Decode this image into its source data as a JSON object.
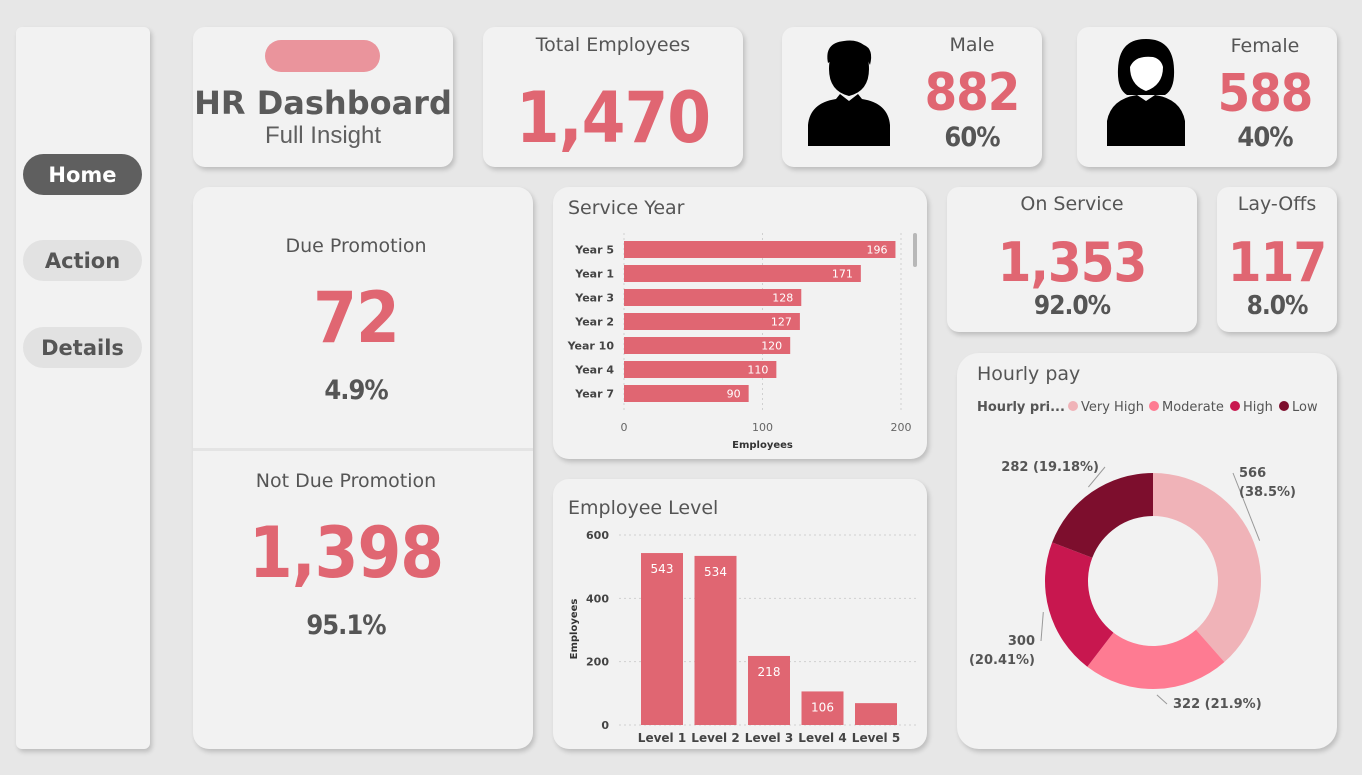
{
  "nav": {
    "home": "Home",
    "action": "Action",
    "details": "Details"
  },
  "title": {
    "main": "HR Dashboard",
    "sub": "Full Insight"
  },
  "total": {
    "label": "Total Employees",
    "value": "1,470"
  },
  "male": {
    "label": "Male",
    "value": "882",
    "pct": "60%"
  },
  "female": {
    "label": "Female",
    "value": "588",
    "pct": "40%"
  },
  "promotion": {
    "due_label": "Due Promotion",
    "due_value": "72",
    "due_pct": "4.9%",
    "notdue_label": "Not Due Promotion",
    "notdue_value": "1,398",
    "notdue_pct": "95.1%"
  },
  "onservice": {
    "label": "On Service",
    "value": "1,353",
    "pct": "92.0%"
  },
  "layoffs": {
    "label": "Lay-Offs",
    "value": "117",
    "pct": "8.0%"
  },
  "colors": {
    "accent": "#e06672",
    "very_high": "#f0b3b8",
    "moderate": "#fe7b92",
    "high": "#c8174f",
    "low": "#7d0e2d"
  },
  "chart_data": [
    {
      "id": "service_year",
      "type": "bar",
      "orientation": "horizontal",
      "title": "Service Year",
      "xlabel": "Employees",
      "categories": [
        "Year 5",
        "Year 1",
        "Year 3",
        "Year 2",
        "Year 10",
        "Year 4",
        "Year 7"
      ],
      "values": [
        196,
        171,
        128,
        127,
        120,
        110,
        90
      ],
      "xticks": [
        "0",
        "100",
        "200"
      ],
      "xlim": [
        0,
        200
      ]
    },
    {
      "id": "employee_level",
      "type": "bar",
      "title": "Employee Level",
      "ylabel": "Employees",
      "categories": [
        "Level 1",
        "Level 2",
        "Level 3",
        "Level 4",
        "Level 5"
      ],
      "values": [
        543,
        534,
        218,
        106,
        69
      ],
      "labels": [
        "543",
        "534",
        "218",
        "106",
        ""
      ],
      "yticks": [
        "0",
        "200",
        "400",
        "600"
      ],
      "ylim": [
        0,
        600
      ]
    },
    {
      "id": "hourly_pay",
      "type": "pie",
      "title": "Hourly pay",
      "legend_title": "Hourly pri...",
      "legend_position": "top",
      "slices": [
        {
          "name": "Very High",
          "value": 566,
          "label1": "566",
          "label2": "(38.5%)"
        },
        {
          "name": "Moderate",
          "value": 322,
          "label1": "322 (21.9%)",
          "label2": ""
        },
        {
          "name": "High",
          "value": 300,
          "label1": "300",
          "label2": "(20.41%)"
        },
        {
          "name": "Low",
          "value": 282,
          "label1": "282 (19.18%)",
          "label2": ""
        }
      ]
    }
  ]
}
